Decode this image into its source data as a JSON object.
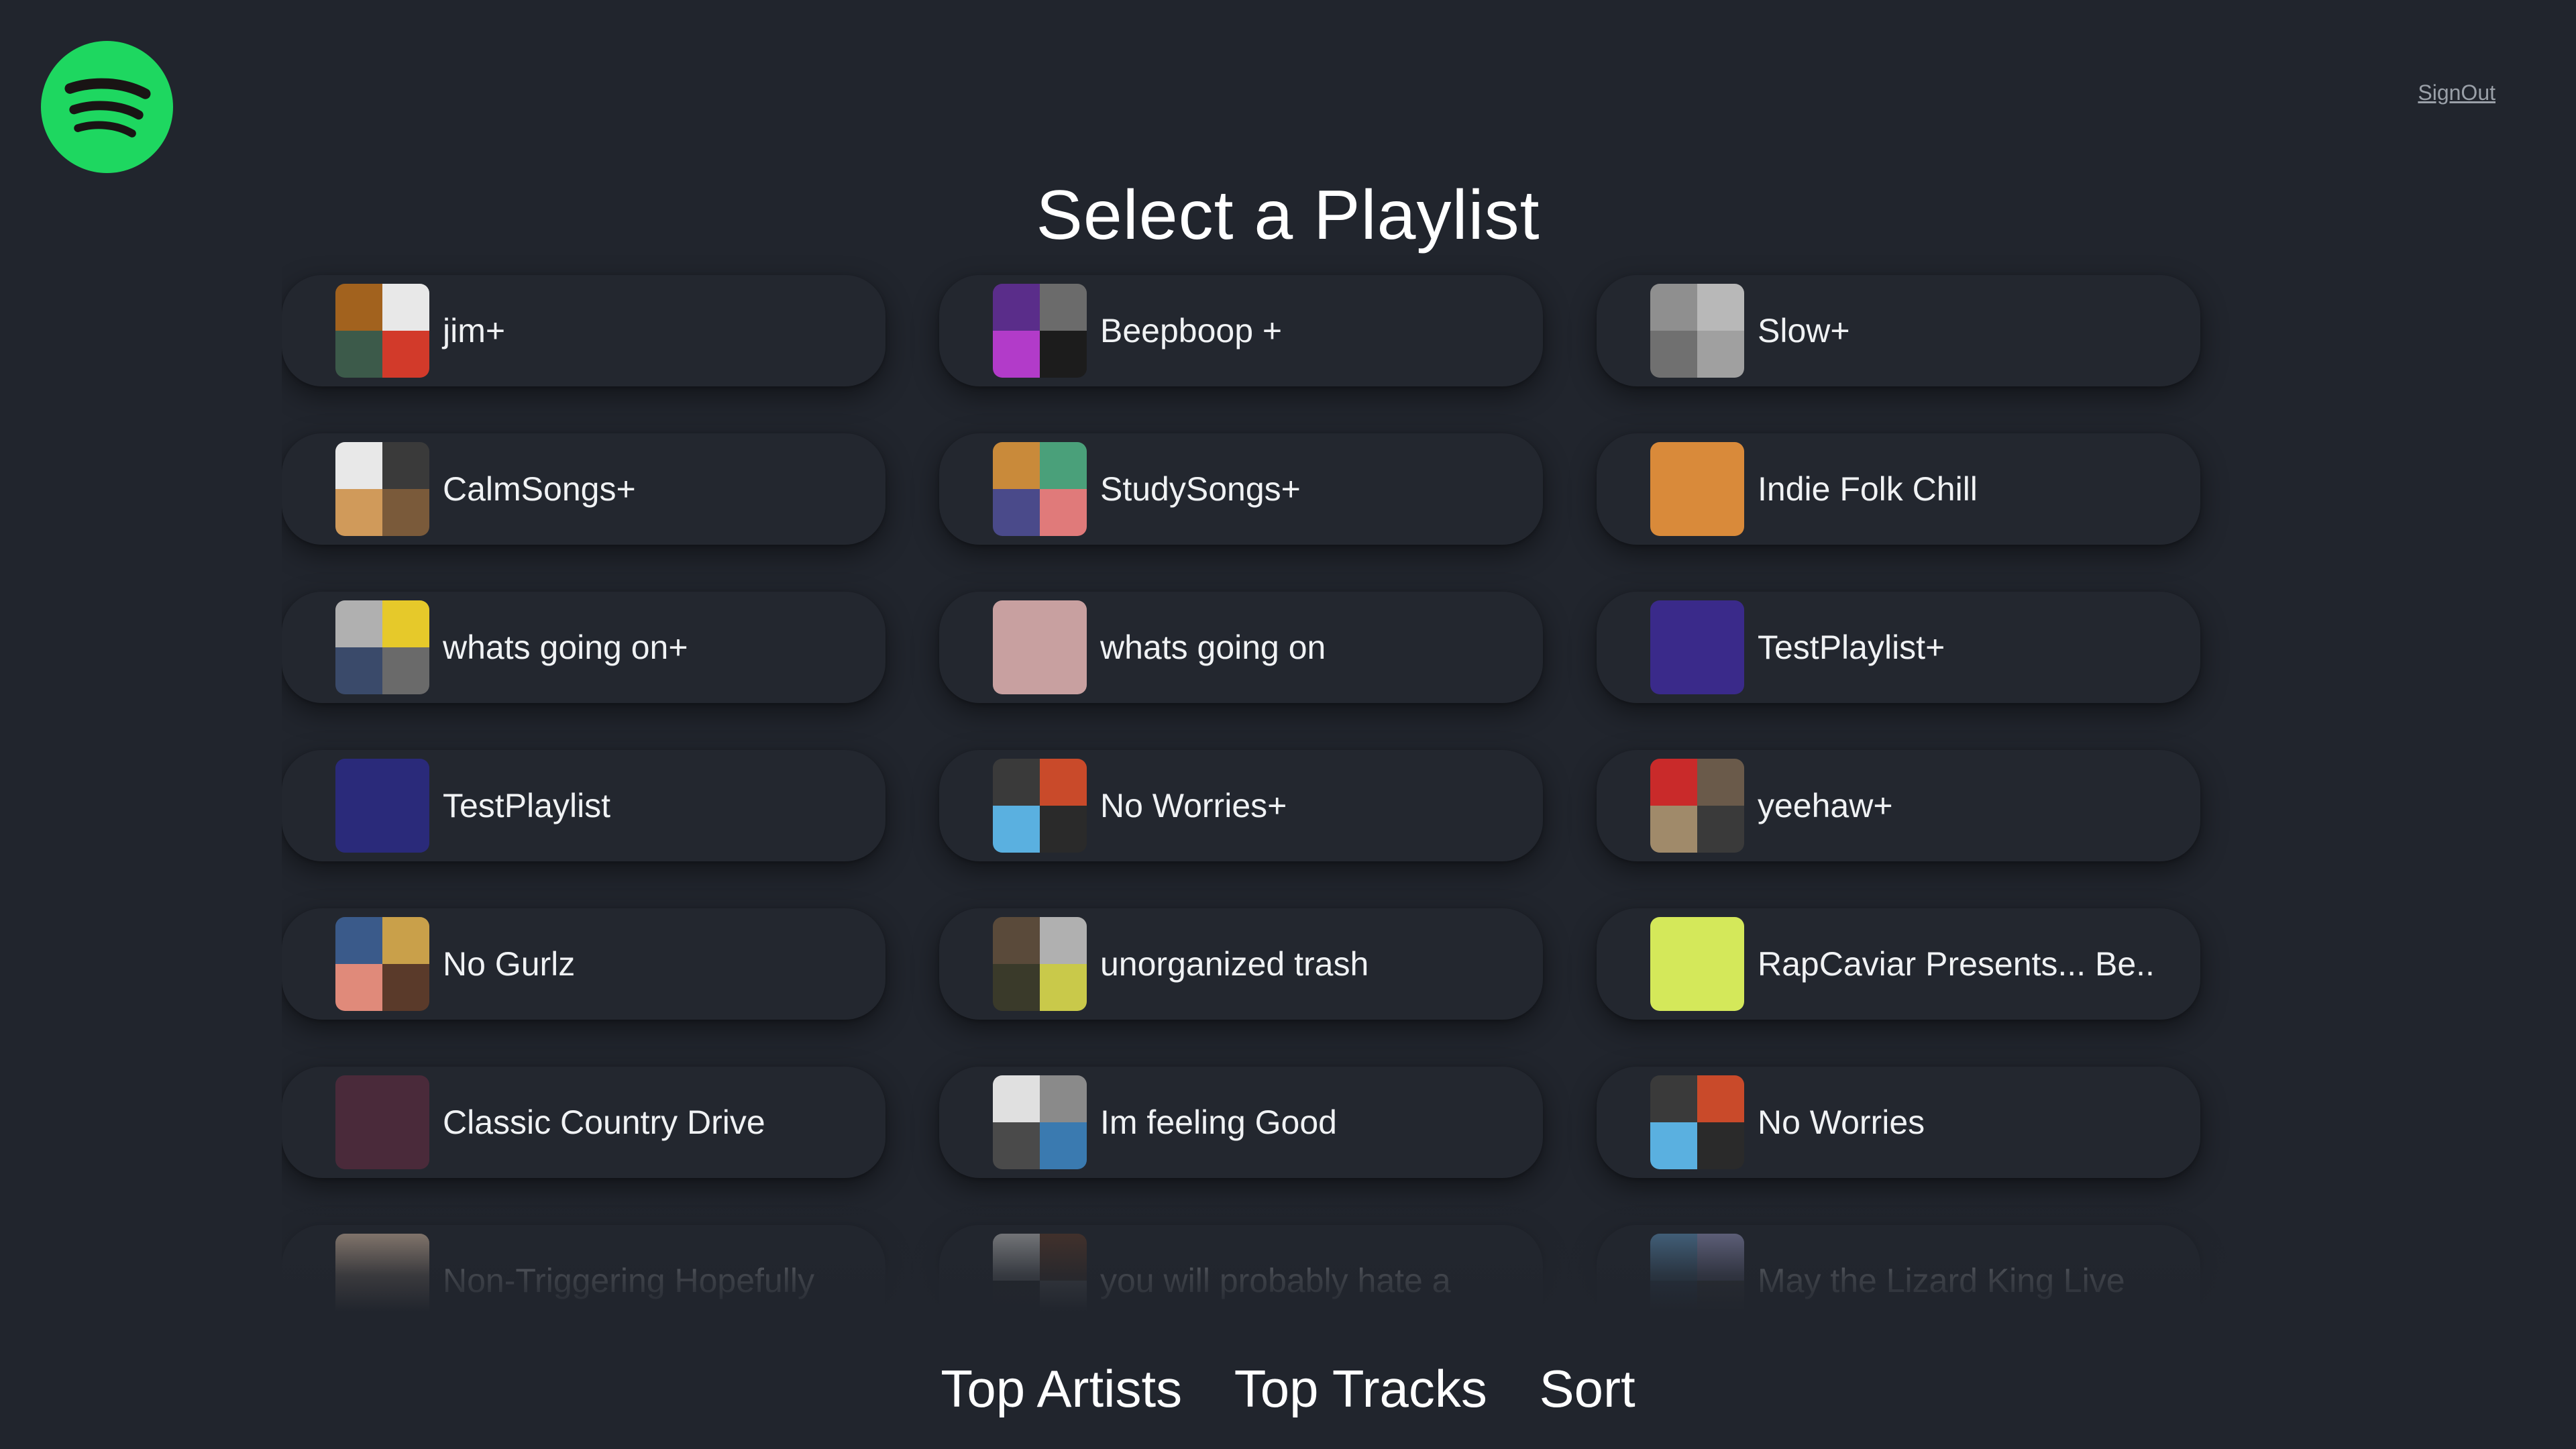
{
  "header": {
    "logo_icon": "spotify-logo-icon",
    "brand_color": "#1ed760",
    "signout_label": "SignOut",
    "title": "Select a Playlist"
  },
  "playlists": [
    {
      "name": "jim+",
      "thumb": [
        "#a2621e",
        "#e8e8e8",
        "#3c5a4a",
        "#d23a2a"
      ]
    },
    {
      "name": "Beepboop +",
      "thumb": [
        "#5a2d8a",
        "#6b6b6b",
        "#b23bc9",
        "#1c1c1c"
      ]
    },
    {
      "name": "Slow+",
      "thumb": [
        "#8f8f8f",
        "#b8b8b8",
        "#707070",
        "#a0a0a0"
      ]
    },
    {
      "name": "CalmSongs+",
      "thumb": [
        "#e8e8e8",
        "#3a3a3a",
        "#d09a5a",
        "#7a5a3a"
      ]
    },
    {
      "name": "StudySongs+",
      "thumb": [
        "#c98a3a",
        "#4aa07a",
        "#4a4a8a",
        "#e07a7a"
      ]
    },
    {
      "name": "Indie Folk Chill",
      "thumb": [
        "#d98a3a"
      ]
    },
    {
      "name": "whats going on+",
      "thumb": [
        "#b0b0b0",
        "#e6c92a",
        "#3a4a6a",
        "#6a6a6a"
      ]
    },
    {
      "name": "whats going on",
      "thumb": [
        "#c8a0a0"
      ]
    },
    {
      "name": "TestPlaylist+",
      "thumb": [
        "#3a2a8a"
      ]
    },
    {
      "name": "TestPlaylist",
      "thumb": [
        "#2a2a7a"
      ]
    },
    {
      "name": "No Worries+",
      "thumb": [
        "#3a3a3a",
        "#c94a2a",
        "#5ab0e0",
        "#2a2a2a"
      ]
    },
    {
      "name": "yeehaw+",
      "thumb": [
        "#c92a2a",
        "#6a5a4a",
        "#a08a6a",
        "#3a3a3a"
      ]
    },
    {
      "name": "No Gurlz",
      "thumb": [
        "#3a5a8a",
        "#c9a04a",
        "#e08a7a",
        "#5a3a2a"
      ]
    },
    {
      "name": "unorganized trash",
      "thumb": [
        "#5a4a3a",
        "#b0b0b0",
        "#3a3a2a",
        "#c9c94a"
      ]
    },
    {
      "name": "RapCaviar Presents... Be..",
      "thumb": [
        "#d4e85a"
      ]
    },
    {
      "name": "Classic Country Drive",
      "thumb": [
        "#4a2a3a"
      ]
    },
    {
      "name": "Im feeling Good",
      "thumb": [
        "#e0e0e0",
        "#8a8a8a",
        "#4a4a4a",
        "#3a7ab0"
      ]
    },
    {
      "name": "No Worries",
      "thumb": [
        "#3a3a3a",
        "#c94a2a",
        "#5ab0e0",
        "#2a2a2a"
      ]
    },
    {
      "name": "Non-Triggering Hopefully",
      "thumb": [
        "#c9b09a"
      ]
    },
    {
      "name": "you will probably hate a",
      "thumb": [
        "#b0b0b0",
        "#5a3a2a",
        "#2a2a2a",
        "#8a8a8a"
      ]
    },
    {
      "name": "May the Lizard King Live",
      "thumb": [
        "#5a8ab0",
        "#8a8ab0",
        "#3a5a7a",
        "#4a4a4a"
      ]
    }
  ],
  "bottom_nav": {
    "top_artists": "Top Artists",
    "top_tracks": "Top Tracks",
    "sort": "Sort"
  }
}
